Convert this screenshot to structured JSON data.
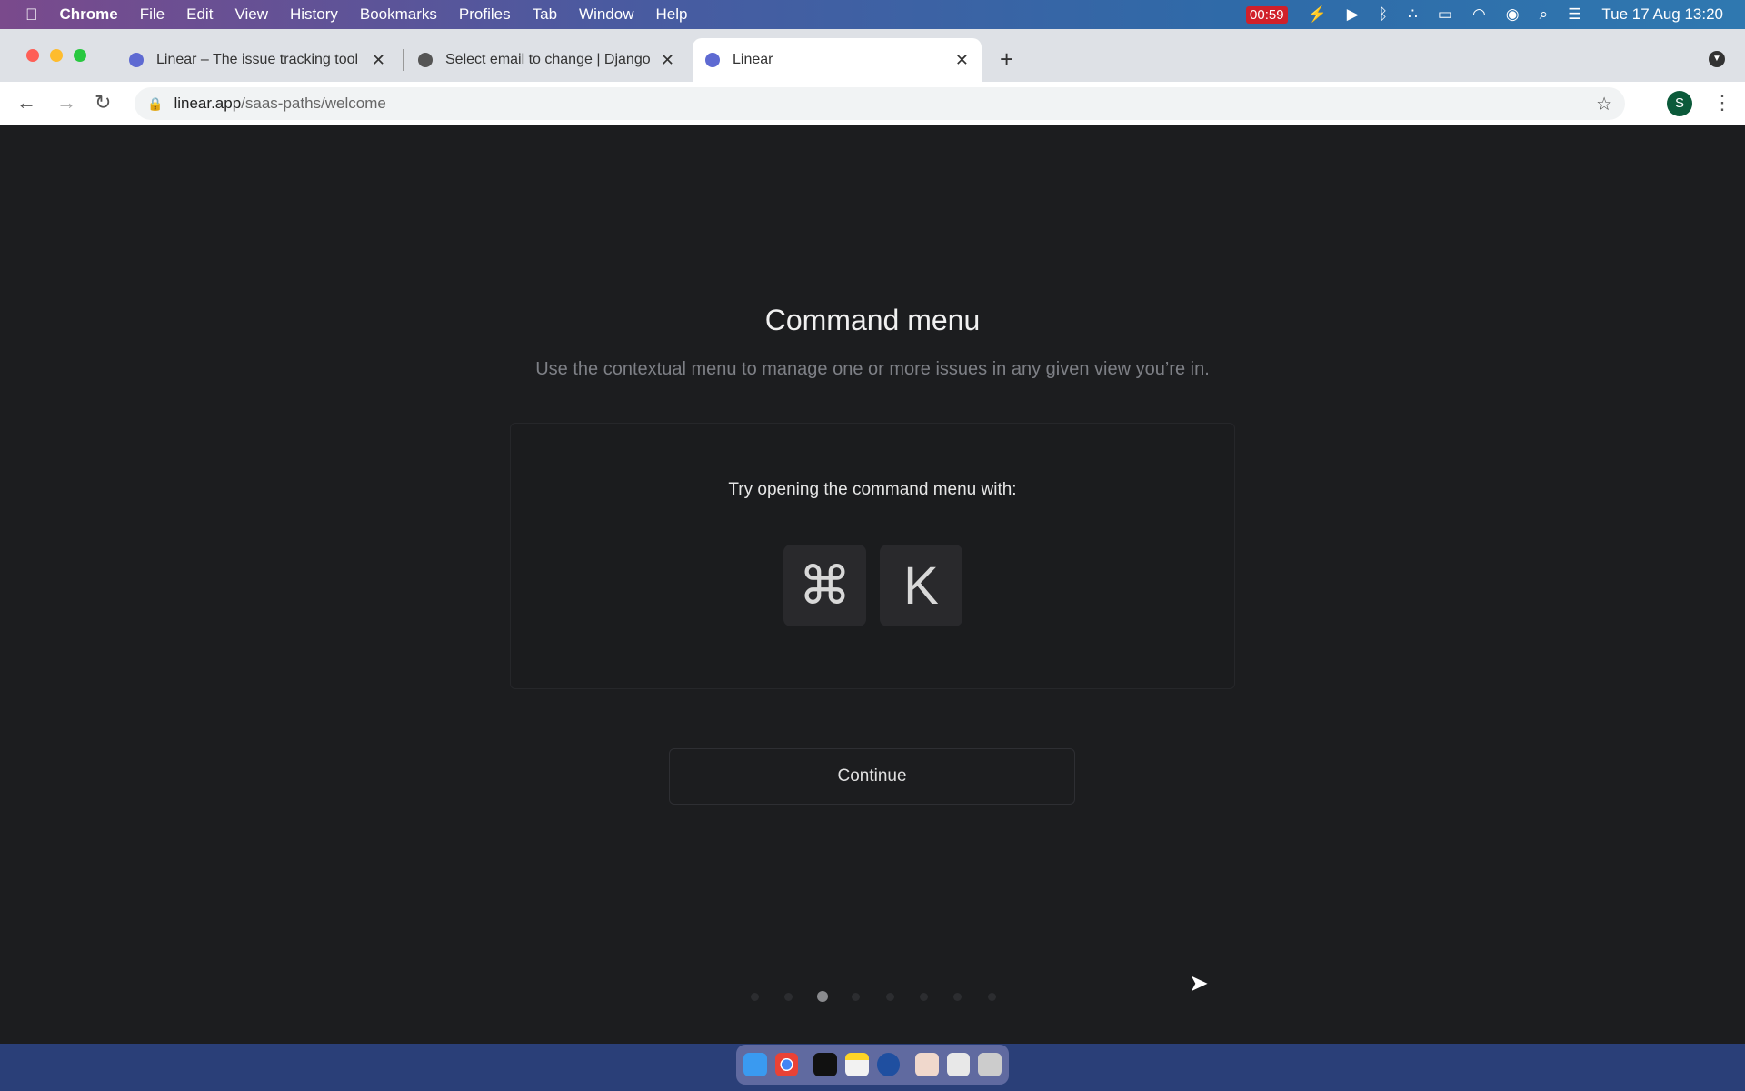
{
  "menubar": {
    "app": "Chrome",
    "items": [
      "File",
      "Edit",
      "View",
      "History",
      "Bookmarks",
      "Profiles",
      "Tab",
      "Window",
      "Help"
    ],
    "timer": "00:59",
    "datetime": "Tue 17 Aug  13:20"
  },
  "tabs": [
    {
      "title": "Linear – The issue tracking tool"
    },
    {
      "title": "Select email to change | Django"
    },
    {
      "title": "Linear"
    }
  ],
  "address": {
    "domain": "linear.app",
    "path": "/saas-paths/welcome"
  },
  "profile_initial": "S",
  "main": {
    "title": "Command menu",
    "subtitle": "Use the contextual menu to manage one or more issues in any given view you’re in.",
    "card_text": "Try opening the command menu with:",
    "keys": [
      "⌘",
      "K"
    ],
    "continue_label": "Continue"
  },
  "pagination": {
    "total": 8,
    "current": 3
  },
  "colors": {
    "background": "#1c1d1f",
    "brand": "#5e6ad2"
  }
}
